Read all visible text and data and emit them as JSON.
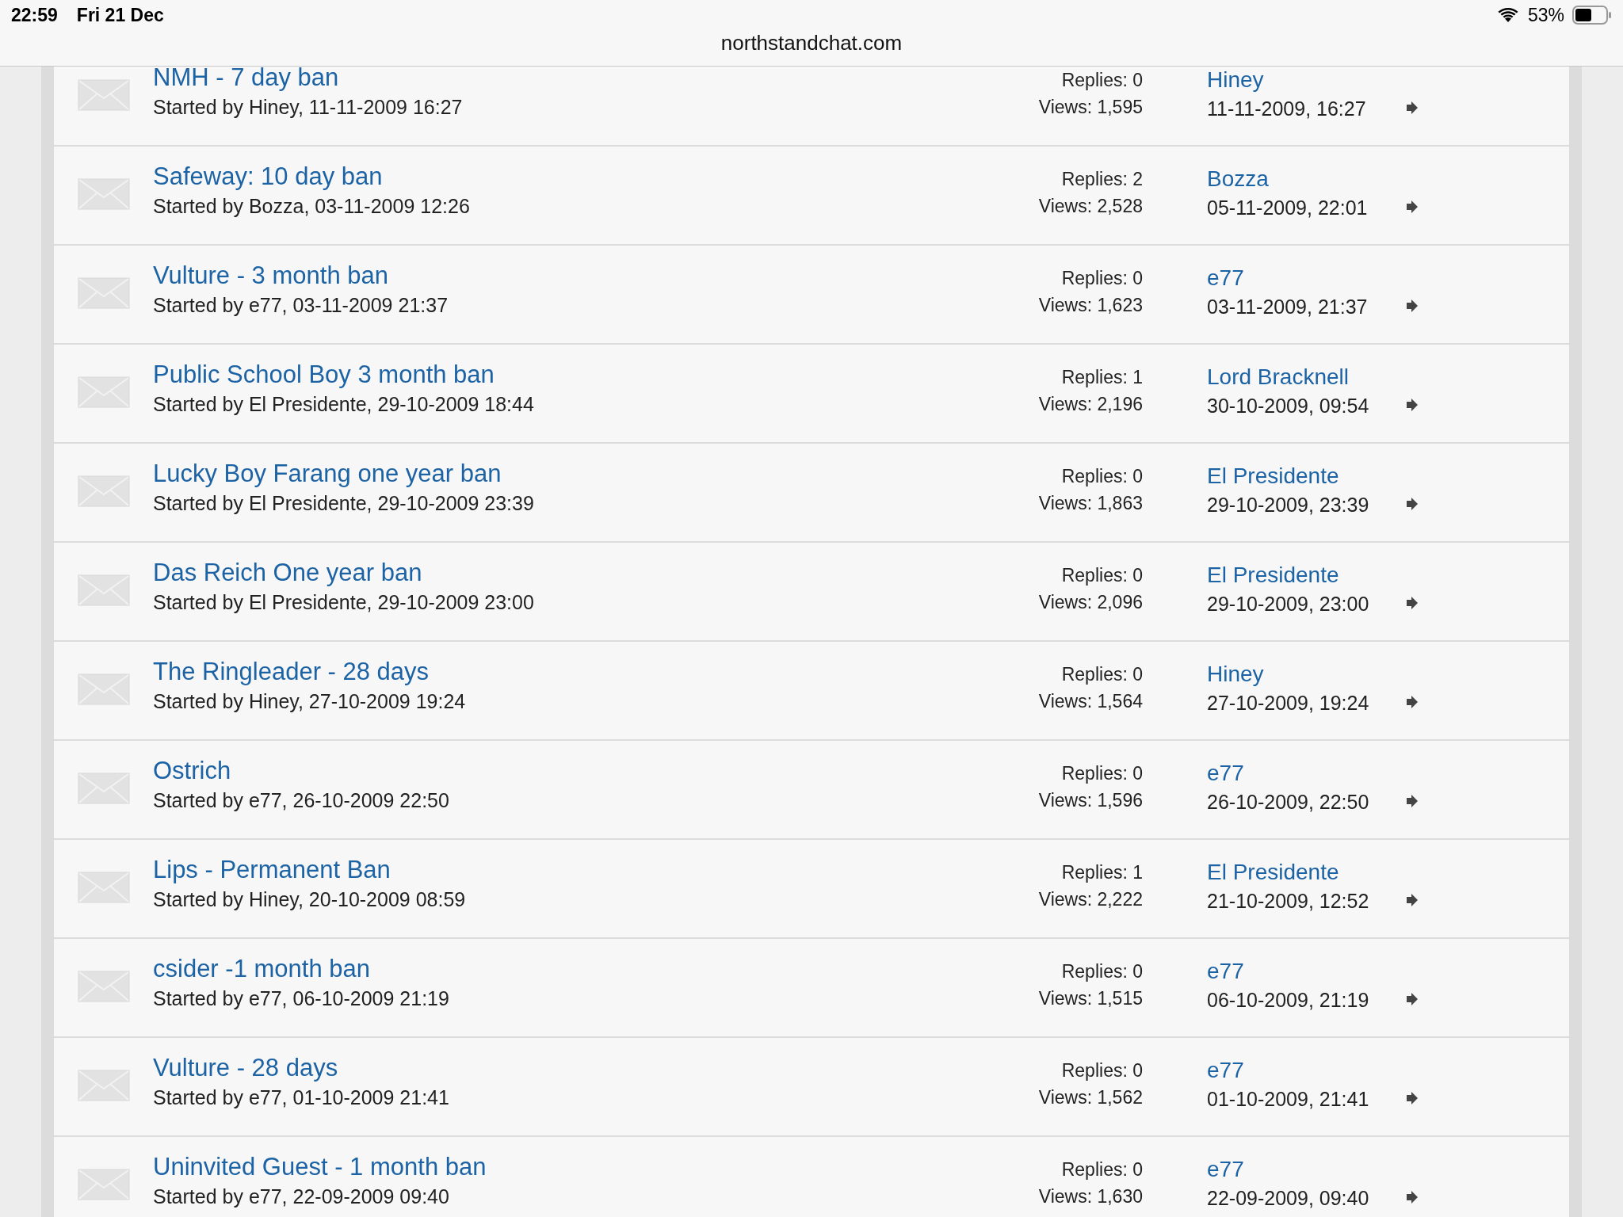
{
  "status_bar": {
    "time": "22:59",
    "date": "Fri 21 Dec",
    "battery": "53%"
  },
  "address_bar": {
    "url": "northstandchat.com"
  },
  "threads": [
    {
      "title": "NMH - 7 day ban",
      "started": "Started by Hiney, 11-11-2009 16:27",
      "replies": "Replies: 0",
      "views": "Views: 1,595",
      "last_poster": "Hiney",
      "last_date": "11-11-2009, 16:27"
    },
    {
      "title": "Safeway: 10 day ban",
      "started": "Started by Bozza, 03-11-2009 12:26",
      "replies": "Replies: 2",
      "views": "Views: 2,528",
      "last_poster": "Bozza",
      "last_date": "05-11-2009, 22:01"
    },
    {
      "title": "Vulture - 3 month ban",
      "started": "Started by e77, 03-11-2009 21:37",
      "replies": "Replies: 0",
      "views": "Views: 1,623",
      "last_poster": "e77",
      "last_date": "03-11-2009, 21:37"
    },
    {
      "title": "Public School Boy 3 month ban",
      "started": "Started by El Presidente, 29-10-2009 18:44",
      "replies": "Replies: 1",
      "views": "Views: 2,196",
      "last_poster": "Lord Bracknell",
      "last_date": "30-10-2009, 09:54"
    },
    {
      "title": "Lucky Boy Farang one year ban",
      "started": "Started by El Presidente, 29-10-2009 23:39",
      "replies": "Replies: 0",
      "views": "Views: 1,863",
      "last_poster": "El Presidente",
      "last_date": "29-10-2009, 23:39"
    },
    {
      "title": "Das Reich One year ban",
      "started": "Started by El Presidente, 29-10-2009 23:00",
      "replies": "Replies: 0",
      "views": "Views: 2,096",
      "last_poster": "El Presidente",
      "last_date": "29-10-2009, 23:00"
    },
    {
      "title": "The Ringleader - 28 days",
      "started": "Started by Hiney, 27-10-2009 19:24",
      "replies": "Replies: 0",
      "views": "Views: 1,564",
      "last_poster": "Hiney",
      "last_date": "27-10-2009, 19:24"
    },
    {
      "title": "Ostrich",
      "started": "Started by e77, 26-10-2009 22:50",
      "replies": "Replies: 0",
      "views": "Views: 1,596",
      "last_poster": "e77",
      "last_date": "26-10-2009, 22:50"
    },
    {
      "title": "Lips - Permanent Ban",
      "started": "Started by Hiney, 20-10-2009 08:59",
      "replies": "Replies: 1",
      "views": "Views: 2,222",
      "last_poster": "El Presidente",
      "last_date": "21-10-2009, 12:52"
    },
    {
      "title": "csider -1 month ban",
      "started": "Started by e77, 06-10-2009 21:19",
      "replies": "Replies: 0",
      "views": "Views: 1,515",
      "last_poster": "e77",
      "last_date": "06-10-2009, 21:19"
    },
    {
      "title": "Vulture - 28 days",
      "started": "Started by e77, 01-10-2009 21:41",
      "replies": "Replies: 0",
      "views": "Views: 1,562",
      "last_poster": "e77",
      "last_date": "01-10-2009, 21:41"
    },
    {
      "title": "Uninvited Guest - 1 month ban",
      "started": "Started by e77, 22-09-2009 09:40",
      "replies": "Replies: 0",
      "views": "Views: 1,630",
      "last_poster": "e77",
      "last_date": "22-09-2009, 09:40"
    }
  ]
}
